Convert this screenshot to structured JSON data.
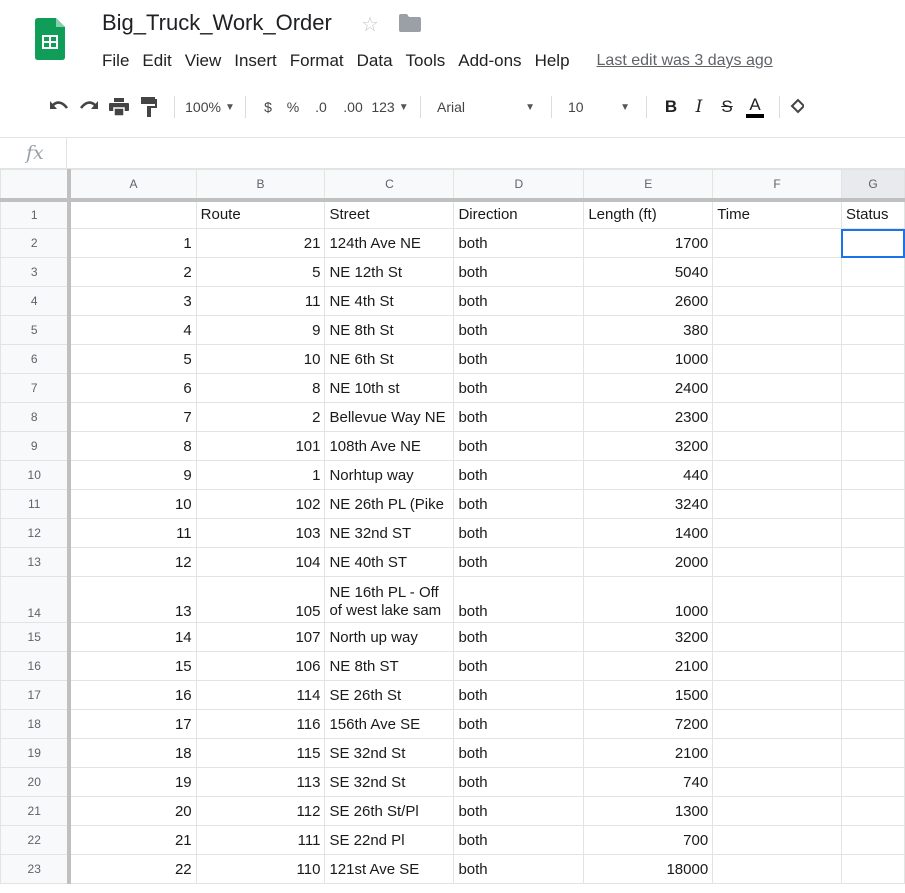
{
  "header": {
    "title": "Big_Truck_Work_Order",
    "last_edit": "Last edit was 3 days ago"
  },
  "menu": [
    "File",
    "Edit",
    "View",
    "Insert",
    "Format",
    "Data",
    "Tools",
    "Add-ons",
    "Help"
  ],
  "toolbar": {
    "zoom": "100%",
    "currency": "$",
    "percent": "%",
    "decrease_decimal": ".0",
    "increase_decimal": ".00",
    "more_formats": "123",
    "font": "Arial",
    "font_size": "10",
    "bold": "B",
    "italic": "I",
    "strikethrough": "S",
    "text_color": "A"
  },
  "formula_bar": {
    "fx": "fx",
    "value": ""
  },
  "grid": {
    "columns": [
      "A",
      "B",
      "C",
      "D",
      "E",
      "F",
      "G"
    ],
    "header_row": {
      "num": "1",
      "cells": [
        "",
        "Route",
        "Street",
        "Direction",
        "Length (ft)",
        "Time",
        "Status"
      ]
    },
    "rows": [
      {
        "num": "2",
        "a": "1",
        "b": "21",
        "c": "124th Ave NE",
        "d": "both",
        "e": "1700"
      },
      {
        "num": "3",
        "a": "2",
        "b": "5",
        "c": "NE 12th St",
        "d": "both",
        "e": "5040"
      },
      {
        "num": "4",
        "a": "3",
        "b": "11",
        "c": "NE 4th St",
        "d": "both",
        "e": "2600"
      },
      {
        "num": "5",
        "a": "4",
        "b": "9",
        "c": "NE 8th St",
        "d": "both",
        "e": "380"
      },
      {
        "num": "6",
        "a": "5",
        "b": "10",
        "c": "NE 6th St",
        "d": "both",
        "e": "1000"
      },
      {
        "num": "7",
        "a": "6",
        "b": "8",
        "c": "NE 10th st",
        "d": "both",
        "e": "2400"
      },
      {
        "num": "8",
        "a": "7",
        "b": "2",
        "c": "Bellevue Way NE",
        "d": "both",
        "e": "2300"
      },
      {
        "num": "9",
        "a": "8",
        "b": "101",
        "c": "108th Ave NE",
        "d": "both",
        "e": "3200"
      },
      {
        "num": "10",
        "a": "9",
        "b": "1",
        "c": "Norhtup way",
        "d": "both",
        "e": "440"
      },
      {
        "num": "11",
        "a": "10",
        "b": "102",
        "c": "NE 26th PL (Pike",
        "d": "both",
        "e": "3240"
      },
      {
        "num": "12",
        "a": "11",
        "b": "103",
        "c": "NE 32nd ST",
        "d": "both",
        "e": "1400"
      },
      {
        "num": "13",
        "a": "12",
        "b": "104",
        "c": "NE 40th ST",
        "d": "both",
        "e": "2000"
      },
      {
        "num": "14",
        "a": "13",
        "b": "105",
        "c": "NE 16th PL - Off of west lake sam",
        "d": "both",
        "e": "1000",
        "tall": true
      },
      {
        "num": "15",
        "a": "14",
        "b": "107",
        "c": "North up way",
        "d": "both",
        "e": "3200"
      },
      {
        "num": "16",
        "a": "15",
        "b": "106",
        "c": "NE 8th ST",
        "d": "both",
        "e": "2100"
      },
      {
        "num": "17",
        "a": "16",
        "b": "114",
        "c": "SE 26th St",
        "d": "both",
        "e": "1500"
      },
      {
        "num": "18",
        "a": "17",
        "b": "116",
        "c": "156th Ave SE",
        "d": "both",
        "e": "7200"
      },
      {
        "num": "19",
        "a": "18",
        "b": "115",
        "c": "SE 32nd St",
        "d": "both",
        "e": "2100"
      },
      {
        "num": "20",
        "a": "19",
        "b": "113",
        "c": "SE 32nd St",
        "d": "both",
        "e": "740"
      },
      {
        "num": "21",
        "a": "20",
        "b": "112",
        "c": "SE 26th St/Pl",
        "d": "both",
        "e": "1300"
      },
      {
        "num": "22",
        "a": "21",
        "b": "111",
        "c": "SE 22nd Pl",
        "d": "both",
        "e": "700"
      },
      {
        "num": "23",
        "a": "22",
        "b": "110",
        "c": "121st Ave SE",
        "d": "both",
        "e": "18000"
      }
    ]
  },
  "colors": {
    "sheets_green": "#0f9d58",
    "selection_blue": "#1a73e8",
    "grid_line": "#e2e3e3",
    "header_bg": "#f8f9fa"
  }
}
